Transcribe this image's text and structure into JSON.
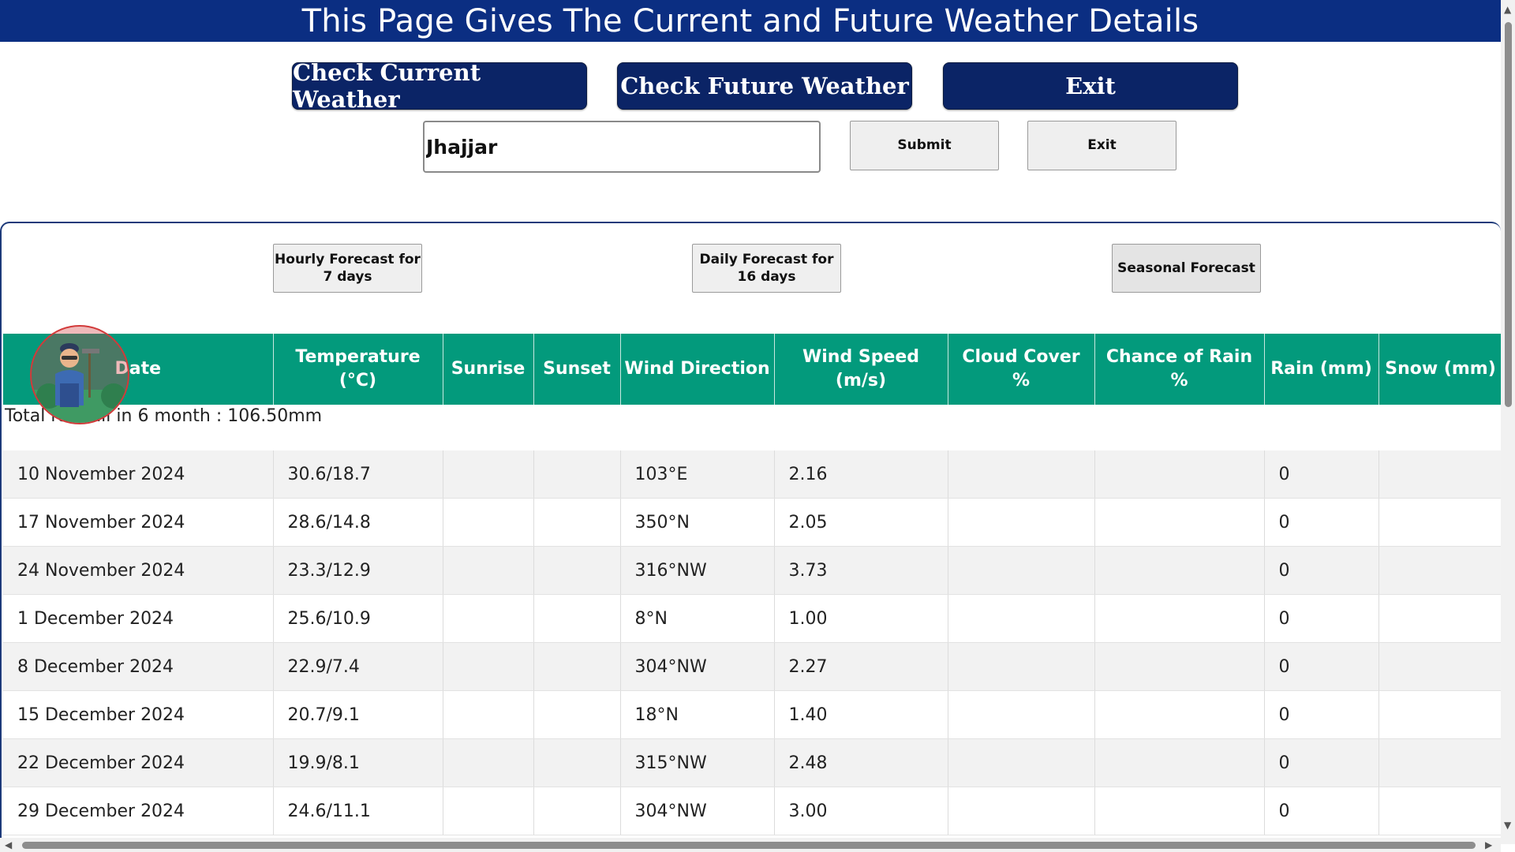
{
  "header": {
    "title": "This Page Gives The Current and Future Weather Details"
  },
  "nav": {
    "current_label": "Check Current Weather",
    "future_label": "Check Future Weather",
    "exit_label": "Exit"
  },
  "search": {
    "value": "Jhajjar",
    "submit_label": "Submit",
    "exit_label": "Exit"
  },
  "forecast_tabs": {
    "hourly_label": "Hourly Forecast for 7 days",
    "daily_label": "Daily Forecast for 16 days",
    "seasonal_label": "Seasonal Forecast"
  },
  "table": {
    "headers": [
      "Date",
      "Temperature (°C)",
      "Sunrise",
      "Sunset",
      "Wind Direction",
      "Wind Speed (m/s)",
      "Cloud Cover %",
      "Chance of Rain %",
      "Rain (mm)",
      "Snow (mm)"
    ],
    "total_rainfall": "Total rainfall in 6 month : 106.50mm",
    "rows": [
      [
        "10 November 2024",
        "30.6/18.7",
        "",
        "",
        "103°E",
        "2.16",
        "",
        "",
        "0",
        ""
      ],
      [
        "17 November 2024",
        "28.6/14.8",
        "",
        "",
        "350°N",
        "2.05",
        "",
        "",
        "0",
        ""
      ],
      [
        "24 November 2024",
        "23.3/12.9",
        "",
        "",
        "316°NW",
        "3.73",
        "",
        "",
        "0",
        ""
      ],
      [
        "1 December 2024",
        "25.6/10.9",
        "",
        "",
        "8°N",
        "1.00",
        "",
        "",
        "0",
        ""
      ],
      [
        "8 December 2024",
        "22.9/7.4",
        "",
        "",
        "304°NW",
        "2.27",
        "",
        "",
        "0",
        ""
      ],
      [
        "15 December 2024",
        "20.7/9.1",
        "",
        "",
        "18°N",
        "1.40",
        "",
        "",
        "0",
        ""
      ],
      [
        "22 December 2024",
        "19.9/8.1",
        "",
        "",
        "315°NW",
        "2.48",
        "",
        "",
        "0",
        ""
      ],
      [
        "29 December 2024",
        "24.6/11.1",
        "",
        "",
        "304°NW",
        "3.00",
        "",
        "",
        "0",
        ""
      ]
    ]
  },
  "colors": {
    "header_bg": "#0b2e82",
    "button_bg": "#0b2466",
    "table_header_bg": "#039a7c"
  }
}
